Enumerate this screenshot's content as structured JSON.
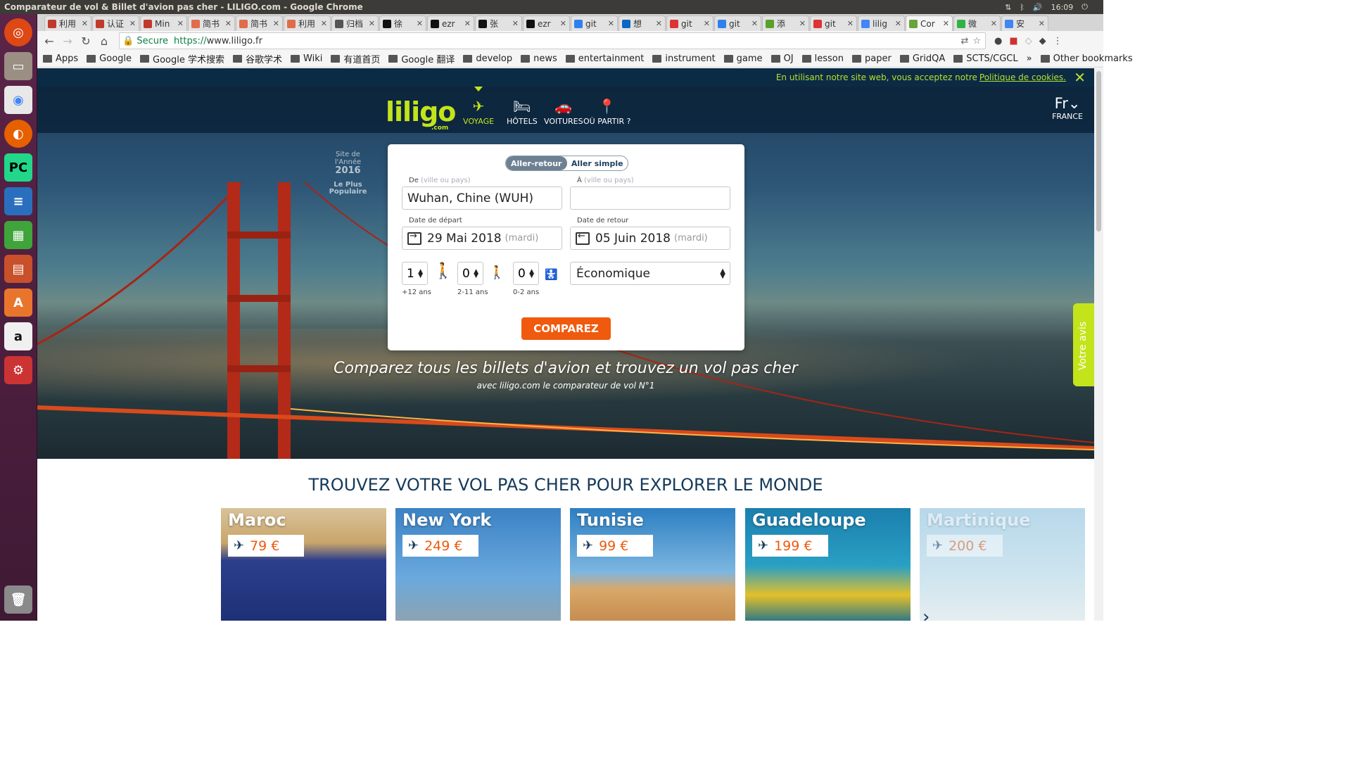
{
  "window": {
    "title": "Comparateur de vol & Billet d'avion pas cher - LILIGO.com - Google Chrome",
    "clock": "16:09"
  },
  "tabs": [
    {
      "label": "利用",
      "color": "#c0392b"
    },
    {
      "label": "认证",
      "color": "#c0392b"
    },
    {
      "label": "Min",
      "color": "#c0392b"
    },
    {
      "label": "简书",
      "color": "#e06c4c"
    },
    {
      "label": "简书",
      "color": "#e06c4c"
    },
    {
      "label": "利用",
      "color": "#e06c4c"
    },
    {
      "label": "归档",
      "color": "#555555"
    },
    {
      "label": "徐",
      "color": "#111111"
    },
    {
      "label": "ezr",
      "color": "#111111"
    },
    {
      "label": "张",
      "color": "#111111"
    },
    {
      "label": "ezr",
      "color": "#111111"
    },
    {
      "label": "git",
      "color": "#2f80ed"
    },
    {
      "label": "想",
      "color": "#0a66c2"
    },
    {
      "label": "git",
      "color": "#d33"
    },
    {
      "label": "git",
      "color": "#2f80ed"
    },
    {
      "label": "添",
      "color": "#5aa02c"
    },
    {
      "label": "git",
      "color": "#d33"
    },
    {
      "label": "lilig",
      "color": "#4285f4"
    },
    {
      "label": "Cor",
      "color": "#6aa33a",
      "active": true
    },
    {
      "label": "微",
      "color": "#2fb344"
    },
    {
      "label": "安",
      "color": "#4285f4"
    }
  ],
  "address": {
    "secure": "Secure",
    "url_scheme": "https://",
    "url_host": "www.liligo.fr"
  },
  "bookmarks": [
    "Apps",
    "Google",
    "Google 学术搜索",
    "谷歌学术",
    "Wiki",
    "有道首页",
    "Google 翻译",
    "develop",
    "news",
    "entertainment",
    "instrument",
    "game",
    "OJ",
    "lesson",
    "paper",
    "GridQA",
    "SCTS/CGCL"
  ],
  "bookmarks_more": "»",
  "other_bookmarks": "Other bookmarks",
  "cookie": {
    "text": "En utilisant notre site web, vous acceptez notre",
    "link": "Politique de cookies."
  },
  "logo": {
    "brand": "liligo",
    "suffix": ".com"
  },
  "nav": {
    "voyage": "VOYAGE",
    "hotels": "HÔTELS",
    "voitures": "VOITURES",
    "ou_partir": "OÙ PARTIR ?"
  },
  "lang": {
    "code": "Fr",
    "country": "FRANCE"
  },
  "award": {
    "l1": "Site de",
    "l2": "l'Année",
    "year": "2016",
    "l3": "Le Plus",
    "l4": "Populaire"
  },
  "search": {
    "trip_round": "Aller-retour",
    "trip_oneway": "Aller simple",
    "from_label": "De",
    "from_hint": "(ville ou pays)",
    "from_value": "Wuhan, Chine (WUH)",
    "to_label": "À",
    "to_hint": "(ville ou pays)",
    "to_value": "",
    "depart_label": "Date de départ",
    "depart_date": "29 Mai 2018",
    "depart_day": "(mardi)",
    "return_label": "Date de retour",
    "return_date": "05 Juin 2018",
    "return_day": "(mardi)",
    "adults": "1",
    "adults_label": "+12 ans",
    "children": "0",
    "children_label": "2-11 ans",
    "infants": "0",
    "infants_label": "0-2 ans",
    "cabin": "Économique",
    "submit": "COMPAREZ"
  },
  "tagline": "Comparez tous les billets d'avion et trouvez un vol pas cher",
  "tagline_sub": "avec liligo.com le comparateur de vol N°1",
  "feedback": "Votre avis",
  "section_title": "TROUVEZ VOTRE VOL PAS CHER POUR EXPLORER LE MONDE",
  "destinations": [
    {
      "name": "Maroc",
      "price": "79 €"
    },
    {
      "name": "New York",
      "price": "249 €"
    },
    {
      "name": "Tunisie",
      "price": "99 €"
    },
    {
      "name": "Guadeloupe",
      "price": "199 €"
    },
    {
      "name": "Martinique",
      "price": "200 €"
    }
  ]
}
